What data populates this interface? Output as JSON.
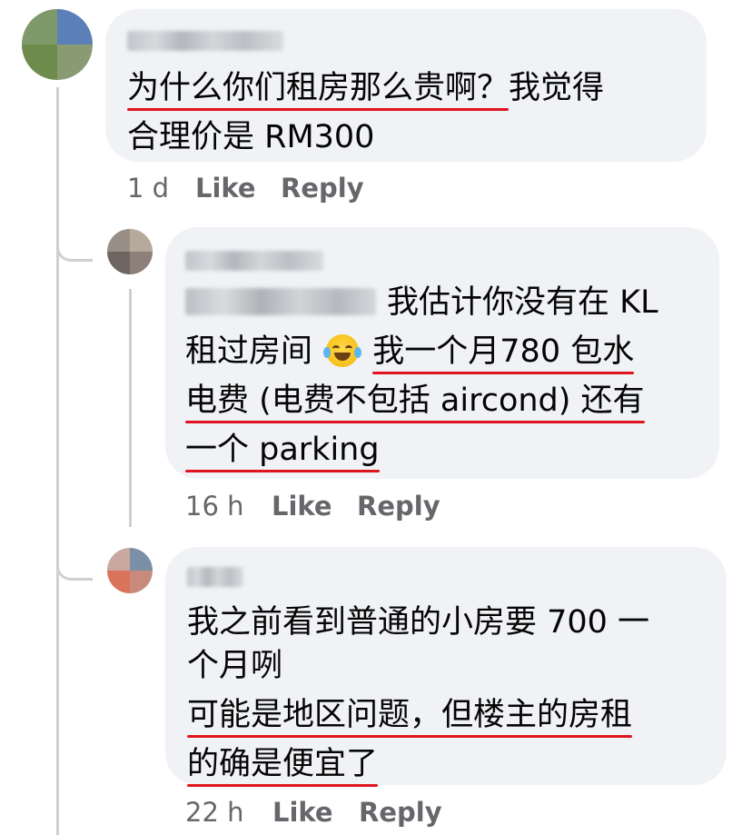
{
  "comments": [
    {
      "lines": [
        {
          "segments": [
            {
              "text": "为什么你们租房那么贵啊？",
              "underline": true
            },
            {
              "text": "我觉得",
              "underline": false
            }
          ]
        },
        {
          "segments": [
            {
              "text": "合理价是 RM300",
              "underline": false
            }
          ]
        }
      ],
      "time": "1 d",
      "like": "Like",
      "reply": "Reply"
    },
    {
      "lines": [
        {
          "segments": [
            {
              "text": "我估计你没有在 KL",
              "underline": false
            }
          ]
        },
        {
          "segments": [
            {
              "text": "租过房间 ",
              "underline": false
            }
          ]
        },
        {
          "segments": [
            {
              "text": "电费 (电费不包括 aircond) 还有",
              "underline": true
            }
          ]
        },
        {
          "segments": [
            {
              "text": "一个 parking",
              "underline": true
            }
          ]
        }
      ],
      "emoji": "face-with-tears-of-joy",
      "underlined_after_emoji": "我一个月780 包水",
      "time": "16 h",
      "like": "Like",
      "reply": "Reply"
    },
    {
      "lines": [
        {
          "segments": [
            {
              "text": "我之前看到普通的小房要 700 一",
              "underline": false
            }
          ]
        },
        {
          "segments": [
            {
              "text": "个月咧",
              "underline": false
            }
          ]
        },
        {
          "segments": [
            {
              "text": "可能是地区问题，但楼主的房租",
              "underline": true
            }
          ]
        },
        {
          "segments": [
            {
              "text": "的确是便宜了",
              "underline": true
            }
          ]
        }
      ],
      "time": "22 h",
      "like": "Like",
      "reply": "Reply"
    }
  ],
  "colors": {
    "bubble": "#f0f2f5",
    "underline": "#e0141e",
    "meta": "#65676b",
    "thread": "#ced0d4"
  }
}
